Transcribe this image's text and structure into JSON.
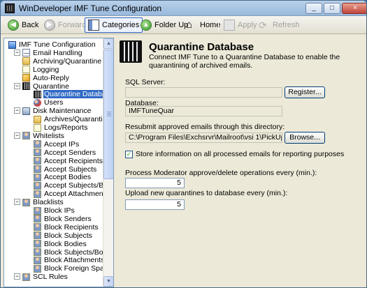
{
  "window": {
    "title": "WinDeveloper IMF Tune Configuration",
    "minimize": "_",
    "maximize": "□",
    "close": "×"
  },
  "toolbar": {
    "back": "Back",
    "forward": "Forward",
    "categories": "Categories",
    "folder_up": "Folder Up",
    "home": "Home",
    "apply": "Apply",
    "refresh": "Refresh"
  },
  "tree": {
    "nodes": [
      {
        "label": "IMF Tune Configuration",
        "icon": "root-icon"
      },
      {
        "label": "Email Handling",
        "icon": "mail-icon"
      },
      {
        "label": "Archiving/Quarantine",
        "icon": "archive-icon"
      },
      {
        "label": "Logging",
        "icon": "log-icon"
      },
      {
        "label": "Auto-Reply",
        "icon": "reply-icon"
      },
      {
        "label": "Quarantine",
        "icon": "bars-icon"
      },
      {
        "label": "Quarantine Database",
        "icon": "bars-icon"
      },
      {
        "label": "Users",
        "icon": "users-icon"
      },
      {
        "label": "Disk Maintenance",
        "icon": "disk-icon"
      },
      {
        "label": "Archives/Quarantine",
        "icon": "archive-icon"
      },
      {
        "label": "Logs/Reports",
        "icon": "log-icon"
      },
      {
        "label": "Whitelists",
        "icon": "person-icon"
      },
      {
        "label": "Accept IPs",
        "icon": "person-icon"
      },
      {
        "label": "Accept Senders",
        "icon": "person-icon"
      },
      {
        "label": "Accept Recipients",
        "icon": "person-icon"
      },
      {
        "label": "Accept Subjects",
        "icon": "person-icon"
      },
      {
        "label": "Accept Bodies",
        "icon": "person-icon"
      },
      {
        "label": "Accept Subjects/Bodies",
        "icon": "person-icon"
      },
      {
        "label": "Accept Attachments",
        "icon": "person-icon"
      },
      {
        "label": "Blacklists",
        "icon": "person-icon"
      },
      {
        "label": "Block IPs",
        "icon": "person-icon"
      },
      {
        "label": "Block Senders",
        "icon": "person-icon"
      },
      {
        "label": "Block Recipients",
        "icon": "person-icon"
      },
      {
        "label": "Block Subjects",
        "icon": "person-icon"
      },
      {
        "label": "Block Bodies",
        "icon": "person-icon"
      },
      {
        "label": "Block Subjects/Bodies",
        "icon": "person-icon"
      },
      {
        "label": "Block Attachments",
        "icon": "person-icon"
      },
      {
        "label": "Block Foreign Spam",
        "icon": "person-icon"
      },
      {
        "label": "SCL Rules",
        "icon": "person-icon"
      }
    ],
    "selected": "Quarantine Database"
  },
  "main": {
    "title": "Quarantine Database",
    "description": "Connect IMF Tune to a Quarantine Database to enable the quarantining of archived emails.",
    "sql_server_label": "SQL Server:",
    "sql_server_value": "",
    "register_button": "Register...",
    "database_label": "Database:",
    "database_value": "IMFTuneQuar",
    "resubmit_label": "Resubmit approved emails through this directory:",
    "resubmit_value": "C:\\Program Files\\Exchsrvr\\Mailroot\\vsi 1\\PickUp",
    "browse_button": "Browse...",
    "store_info_label": "Store information on all processed emails for reporting purposes",
    "store_info_checked": true,
    "moderator_label": "Process Moderator approve/delete operations every (min.):",
    "moderator_value": "5",
    "upload_label": "Upload new quarantines to database every (min.):",
    "upload_value": "5"
  }
}
